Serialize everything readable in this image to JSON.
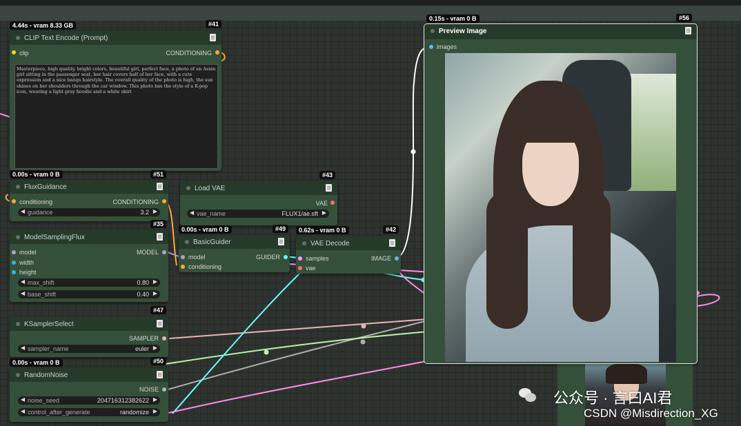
{
  "colors": {
    "node_body": "#35503a",
    "node_header": "#263a2a",
    "conditioning": "#ffa931",
    "vae": "#ff6e6e",
    "image": "#64b5f6",
    "model": "#b39ddb",
    "int": "#29b6f6",
    "sampler": "#ecb4b4",
    "guider": "#66ffff",
    "noise": "#b0b0b0"
  },
  "nodes": {
    "clip": {
      "badge": "4.44s - vram 8.33 GB",
      "id": "#41",
      "title": "CLIP Text Encode (Prompt)",
      "input": "clip",
      "output": "CONDITIONING",
      "prompt": "Masterpiece, high quality, bright colors, beautiful girl, perfect face, a photo of an Asian girl sitting in the passenger seat, her hair covers half of her face, with a cute expression and a nice bangs hairstyle. The overall quality of the photo is high, the sun shines on her shoulders through the car window. This photo has the style of a K-pop icon, wearing a light gray hoodie and a white skirt"
    },
    "flux_guidance": {
      "badge": "0.00s - vram 0 B",
      "id": "#51",
      "title": "FluxGuidance",
      "input": "conditioning",
      "output": "CONDITIONING",
      "widget_label": "guidance",
      "widget_value": "3.2"
    },
    "load_vae": {
      "id": "#43",
      "title": "Load VAE",
      "output": "VAE",
      "widget_label": "vae_name",
      "widget_value": "FLUX1/ae.sft"
    },
    "model_sampling": {
      "id": "#35",
      "title": "ModelSamplingFlux",
      "inputs": [
        "model",
        "width",
        "height"
      ],
      "output": "MODEL",
      "widgets": [
        {
          "label": "max_shift",
          "value": "0.80"
        },
        {
          "label": "base_shift",
          "value": "0.40"
        }
      ]
    },
    "basic_guider": {
      "badge": "0.00s - vram 0 B",
      "id": "#49",
      "title": "BasicGuider",
      "inputs": [
        "model",
        "conditioning"
      ],
      "output": "GUIDER"
    },
    "vae_decode": {
      "badge": "0.62s - vram 0 B",
      "id": "#42",
      "title": "VAE Decode",
      "inputs": [
        "samples",
        "vae"
      ],
      "output": "IMAGE"
    },
    "ksampler_select": {
      "id": "#47",
      "title": "KSamplerSelect",
      "output": "SAMPLER",
      "widget_label": "sampler_name",
      "widget_value": "euler"
    },
    "random_noise": {
      "badge": "0.00s - vram 0 B",
      "id": "#50",
      "title": "RandomNoise",
      "output": "NOISE",
      "widgets": [
        {
          "label": "noise_seed",
          "value": "204716312382622"
        },
        {
          "label": "control_after_generate",
          "value": "randomize"
        }
      ]
    },
    "preview": {
      "badge": "0.15s - vram 0 B",
      "id": "#56",
      "title": "Preview Image",
      "input": "images"
    }
  },
  "watermark": {
    "line1": "公众号 · 言曰AI君",
    "line2": "CSDN @Misdirection_XG"
  }
}
